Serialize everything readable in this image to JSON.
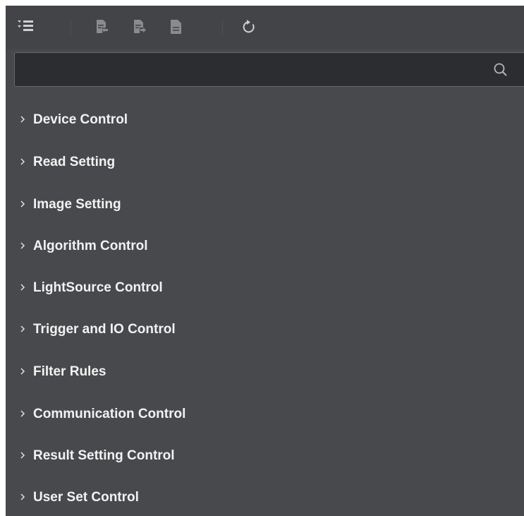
{
  "toolbar": {
    "buttons": [
      {
        "icon": "expand-collapse-list-icon"
      },
      {
        "icon": "import-config-icon"
      },
      {
        "icon": "export-config-icon"
      },
      {
        "icon": "document-icon"
      },
      {
        "icon": "refresh-icon"
      }
    ]
  },
  "search": {
    "value": "",
    "placeholder": "",
    "icon": "search-icon"
  },
  "tree": {
    "items": [
      {
        "label": "Device Control"
      },
      {
        "label": "Read Setting"
      },
      {
        "label": "Image Setting"
      },
      {
        "label": "Algorithm Control"
      },
      {
        "label": "LightSource Control"
      },
      {
        "label": "Trigger and IO Control"
      },
      {
        "label": "Filter Rules"
      },
      {
        "label": "Communication Control"
      },
      {
        "label": "Result Setting Control"
      },
      {
        "label": "User Set Control"
      }
    ]
  },
  "colors": {
    "panel_bg": "#48494c",
    "toolbar_bg": "#434447",
    "search_bg": "#2c2d30",
    "text": "#f2f2f2",
    "icon": "#cfcfcf",
    "icon_dim": "#8a8b8f"
  }
}
